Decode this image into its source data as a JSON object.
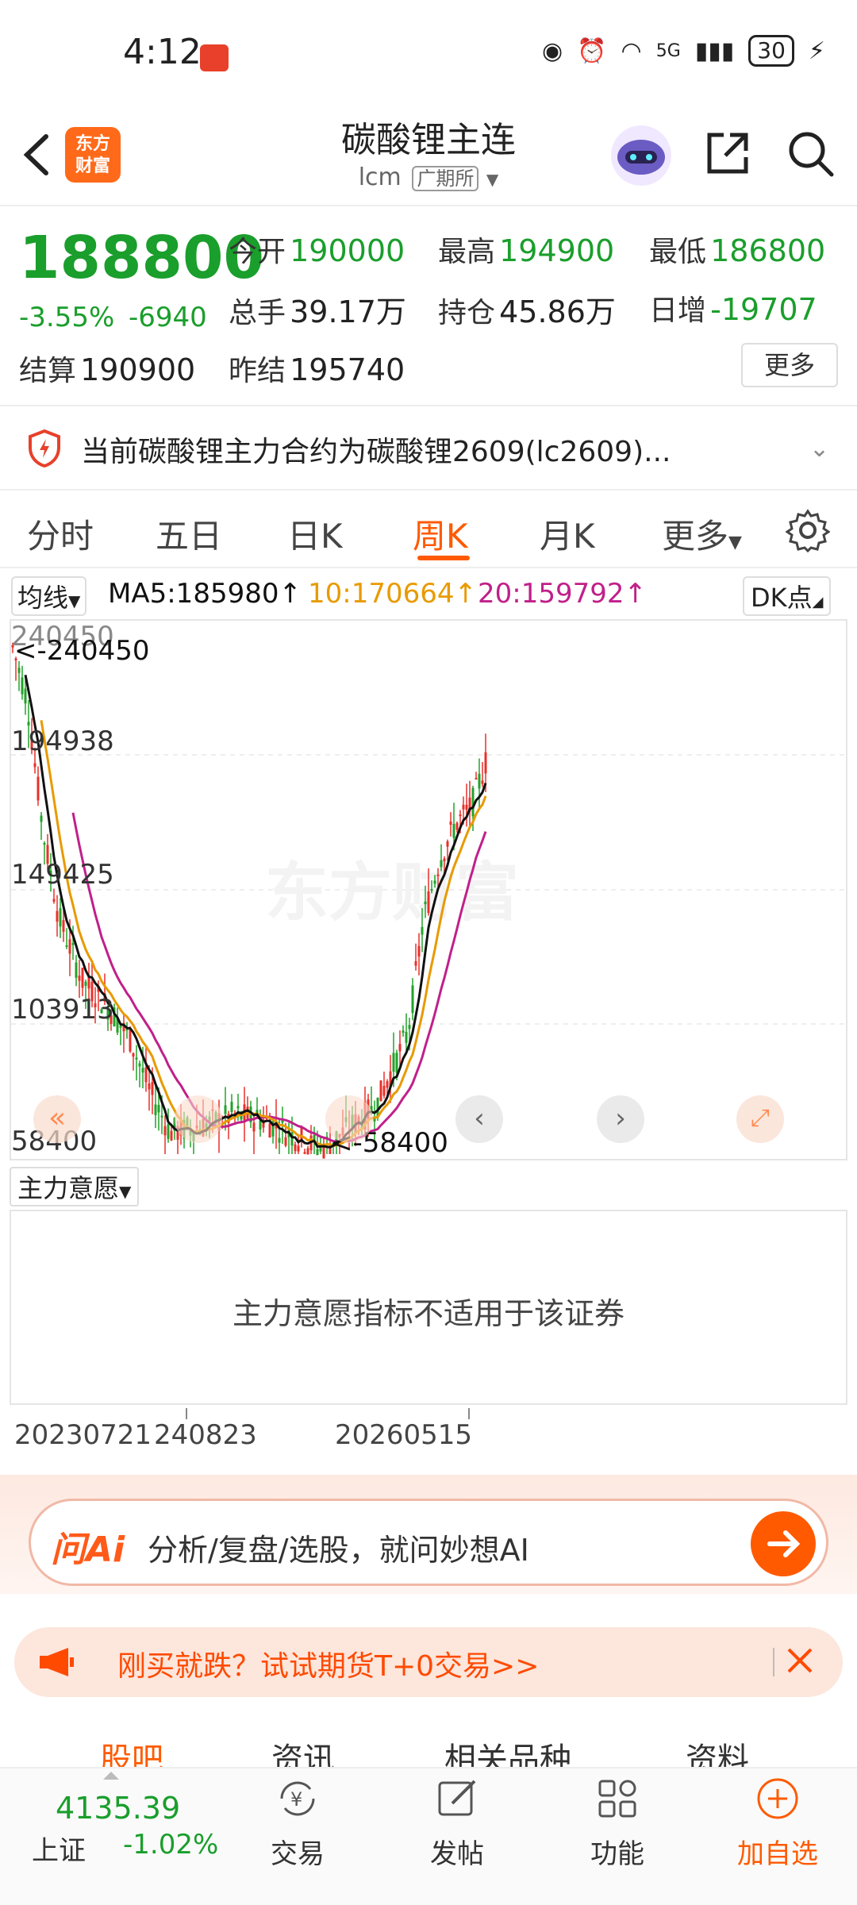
{
  "status": {
    "time": "4:12",
    "network": "5G",
    "battery": "30"
  },
  "header": {
    "title": "碳酸锂主连",
    "code": "lcm",
    "exchange": "广期所",
    "logo_text_1": "东方",
    "logo_text_2": "财富"
  },
  "quote": {
    "price": "188800",
    "change_pct": "-3.55%",
    "change_abs": "-6940",
    "open_label": "今开",
    "open": "190000",
    "high_label": "最高",
    "high": "194900",
    "low_label": "最低",
    "low": "186800",
    "volume_label": "总手",
    "volume": "39.17万",
    "oi_label": "持仓",
    "oi": "45.86万",
    "daily_inc_label": "日增",
    "daily_inc": "-19707",
    "settle_label": "结算",
    "settle": "190900",
    "prev_settle_label": "昨结",
    "prev_settle": "195740",
    "more_button": "更多"
  },
  "notice": {
    "text": "当前碳酸锂主力合约为碳酸锂2609(lc2609)..."
  },
  "tabs": [
    "分时",
    "五日",
    "日K",
    "周K",
    "月K",
    "更多"
  ],
  "active_tab": "周K",
  "indicators": {
    "ma_button": "均线",
    "ma5": "MA5:185980↑",
    "ma10": "10:170664↑",
    "ma20": "20:159792↑",
    "dk_button": "DK点",
    "ma5_color": "#111111",
    "ma10_color": "#e89a00",
    "ma20_color": "#c0208a"
  },
  "chart": {
    "y_labels": [
      "240450",
      "194938",
      "149425",
      "103913",
      "58400"
    ],
    "max_marker": "<-240450",
    "min_marker": "<-58400",
    "watermark": "东方财富",
    "up_color": "#e8302a",
    "down_color": "#22a22a"
  },
  "sub_indicator": {
    "button": "主力意愿",
    "message": "主力意愿指标不适用于该证券"
  },
  "x_dates": [
    "20230721",
    "240823",
    "20260515"
  ],
  "ai": {
    "logo": "问Ai",
    "placeholder": "分析/复盘/选股，就问妙想AI"
  },
  "promo": {
    "text": "刚买就跌？试试期货T+0交易>>"
  },
  "sub_tabs": [
    "股吧",
    "资讯",
    "相关品种",
    "资料"
  ],
  "bottom": {
    "index_value": "4135.39",
    "index_name": "上证",
    "index_change": "-1.02%",
    "nav": [
      "交易",
      "发帖",
      "功能",
      "加自选"
    ]
  }
}
